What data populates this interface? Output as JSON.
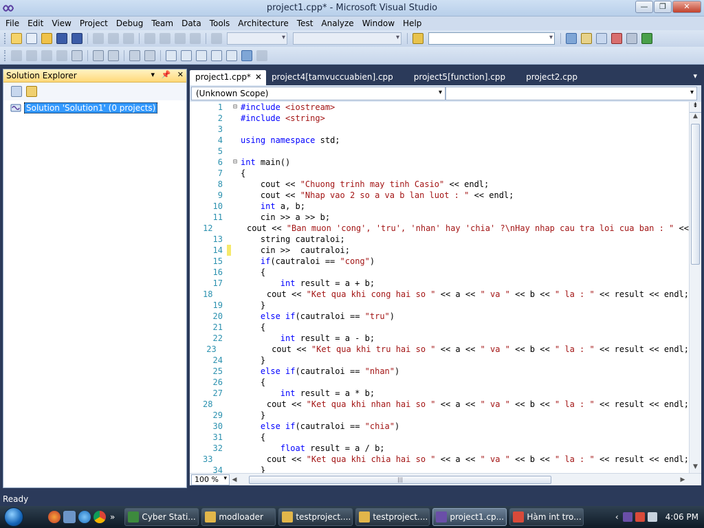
{
  "window": {
    "title": "project1.cpp* - Microsoft Visual Studio",
    "buttons": {
      "minimize": "—",
      "maximize": "❐",
      "close": "✕"
    }
  },
  "menu": [
    "File",
    "Edit",
    "View",
    "Project",
    "Debug",
    "Team",
    "Data",
    "Tools",
    "Architecture",
    "Test",
    "Analyze",
    "Window",
    "Help"
  ],
  "solution_explorer": {
    "title": "Solution Explorer",
    "controls": {
      "dropdown": "▾",
      "pin": "📌",
      "close": "✕"
    },
    "tree": [
      {
        "label": "Solution 'Solution1' (0 projects)"
      }
    ]
  },
  "tabs": [
    {
      "label": "project1.cpp*",
      "active": true,
      "close": "✕"
    },
    {
      "label": "project4[tamvuccuabien].cpp",
      "active": false
    },
    {
      "label": "project5[function].cpp",
      "active": false
    },
    {
      "label": "project2.cpp",
      "active": false
    }
  ],
  "tabs_overflow": "▾",
  "scope": {
    "left": "(Unknown Scope)",
    "right": ""
  },
  "code": [
    {
      "n": "1",
      "fold": "⊟",
      "html": "<span class=\"kw\">#include</span> <span class=\"str\">&lt;iostream&gt;</span>"
    },
    {
      "n": "2",
      "html": "<span class=\"kw\">#include</span> <span class=\"str\">&lt;string&gt;</span>"
    },
    {
      "n": "3",
      "html": ""
    },
    {
      "n": "4",
      "html": "<span class=\"kw\">using</span> <span class=\"kw\">namespace</span> std;"
    },
    {
      "n": "5",
      "html": ""
    },
    {
      "n": "6",
      "fold": "⊟",
      "html": "<span class=\"kw\">int</span> main()"
    },
    {
      "n": "7",
      "html": "{"
    },
    {
      "n": "8",
      "html": "    cout &lt;&lt; <span class=\"str\">\"Chuong trinh may tinh Casio\"</span> &lt;&lt; endl;"
    },
    {
      "n": "9",
      "html": "    cout &lt;&lt; <span class=\"str\">\"Nhap vao 2 so a va b lan luot : \"</span> &lt;&lt; endl;"
    },
    {
      "n": "10",
      "html": "    <span class=\"kw\">int</span> a, b;"
    },
    {
      "n": "11",
      "html": "    cin &gt;&gt; a &gt;&gt; b;"
    },
    {
      "n": "12",
      "html": "    cout &lt;&lt; <span class=\"str\">\"Ban muon 'cong', 'tru', 'nhan' hay 'chia' ?\\nHay nhap cau tra loi cua ban : \"</span> &lt;&lt;"
    },
    {
      "n": "13",
      "html": "    string cautraloi;"
    },
    {
      "n": "14",
      "mark": true,
      "html": "    cin &gt;&gt;  cautraloi;"
    },
    {
      "n": "15",
      "html": "    <span class=\"kw\">if</span>(cautraloi == <span class=\"str\">\"cong\"</span>)"
    },
    {
      "n": "16",
      "html": "    {"
    },
    {
      "n": "17",
      "html": "        <span class=\"kw\">int</span> result = a + b;"
    },
    {
      "n": "18",
      "html": "        cout &lt;&lt; <span class=\"str\">\"Ket qua khi cong hai so \"</span> &lt;&lt; a &lt;&lt; <span class=\"str\">\" va \"</span> &lt;&lt; b &lt;&lt; <span class=\"str\">\" la : \"</span> &lt;&lt; result &lt;&lt; endl;"
    },
    {
      "n": "19",
      "html": "    }"
    },
    {
      "n": "20",
      "html": "    <span class=\"kw\">else</span> <span class=\"kw\">if</span>(cautraloi == <span class=\"str\">\"tru\"</span>)"
    },
    {
      "n": "21",
      "html": "    {"
    },
    {
      "n": "22",
      "html": "        <span class=\"kw\">int</span> result = a - b;"
    },
    {
      "n": "23",
      "html": "        cout &lt;&lt; <span class=\"str\">\"Ket qua khi tru hai so \"</span> &lt;&lt; a &lt;&lt; <span class=\"str\">\" va \"</span> &lt;&lt; b &lt;&lt; <span class=\"str\">\" la : \"</span> &lt;&lt; result &lt;&lt; endl;"
    },
    {
      "n": "24",
      "html": "    }"
    },
    {
      "n": "25",
      "html": "    <span class=\"kw\">else</span> <span class=\"kw\">if</span>(cautraloi == <span class=\"str\">\"nhan\"</span>)"
    },
    {
      "n": "26",
      "html": "    {"
    },
    {
      "n": "27",
      "html": "        <span class=\"kw\">int</span> result = a * b;"
    },
    {
      "n": "28",
      "html": "        cout &lt;&lt; <span class=\"str\">\"Ket qua khi nhan hai so \"</span> &lt;&lt; a &lt;&lt; <span class=\"str\">\" va \"</span> &lt;&lt; b &lt;&lt; <span class=\"str\">\" la : \"</span> &lt;&lt; result &lt;&lt; endl;"
    },
    {
      "n": "29",
      "html": "    }"
    },
    {
      "n": "30",
      "html": "    <span class=\"kw\">else</span> <span class=\"kw\">if</span>(cautraloi == <span class=\"str\">\"chia\"</span>)"
    },
    {
      "n": "31",
      "html": "    {"
    },
    {
      "n": "32",
      "html": "        <span class=\"kw\">float</span> result = a / b;"
    },
    {
      "n": "33",
      "html": "        cout &lt;&lt; <span class=\"str\">\"Ket qua khi chia hai so \"</span> &lt;&lt; a &lt;&lt; <span class=\"str\">\" va \"</span> &lt;&lt; b &lt;&lt; <span class=\"str\">\" la : \"</span> &lt;&lt; result &lt;&lt; endl;"
    },
    {
      "n": "34",
      "html": "    }"
    }
  ],
  "zoom": "100 %",
  "status": "Ready",
  "taskbar": {
    "quick_more": "»",
    "tasks": [
      {
        "label": "Cyber Stati...",
        "color": "#3d8a3d"
      },
      {
        "label": "modloader",
        "color": "#e2b64a"
      },
      {
        "label": "testproject....",
        "color": "#e2b64a"
      },
      {
        "label": "testproject....",
        "color": "#e2b64a"
      },
      {
        "label": "project1.cp...",
        "color": "#6a4fa8",
        "active": true
      },
      {
        "label": "Hàm int tro...",
        "color": "#d94a3a"
      }
    ],
    "tray_arrow": "‹",
    "clock": "4:06 PM"
  },
  "colors": {
    "keyword": "#0000ff",
    "string": "#a31515",
    "line_number": "#2b91af",
    "accent": "#2b3a5a"
  }
}
